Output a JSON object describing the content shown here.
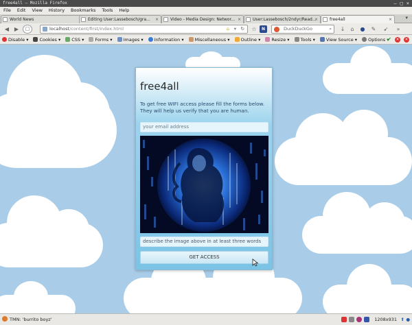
{
  "window": {
    "title": "free4all – Mozilla Firefox"
  },
  "menu": [
    "File",
    "Edit",
    "View",
    "History",
    "Bookmarks",
    "Tools",
    "Help"
  ],
  "tabs": [
    {
      "label": "World News",
      "active": false
    },
    {
      "label": "Editing User:Lassebosch/gra...",
      "active": false
    },
    {
      "label": "Video - Media Design: Networ...",
      "active": false
    },
    {
      "label": "User:Lassebosch/2ndyr/Read...",
      "active": false
    },
    {
      "label": "free4all",
      "active": true
    }
  ],
  "nav": {
    "url_host": "localhost",
    "url_path": "/content/first/index.html",
    "search_placeholder": "DuckDuckGo"
  },
  "devtools": [
    "Disable",
    "Cookies",
    "CSS",
    "Forms",
    "Images",
    "Information",
    "Miscellaneous",
    "Outline",
    "Resize",
    "Tools",
    "View Source",
    "Options"
  ],
  "page": {
    "title": "free4all",
    "intro": "To get free WIFI access please fill the forms below. They will help us verify that you are human.",
    "email_placeholder": "your email address",
    "describe_placeholder": "describe the image above in at least three words",
    "submit_label": "GET ACCESS"
  },
  "status": {
    "left_text": "TMN: 'burrito boyz'",
    "resolution": "1208x931"
  },
  "colors": {
    "sky": "#a9cde8",
    "card_top": "#ffffff",
    "card_bottom": "#7bc4e6",
    "button": "#c9e7f5"
  }
}
